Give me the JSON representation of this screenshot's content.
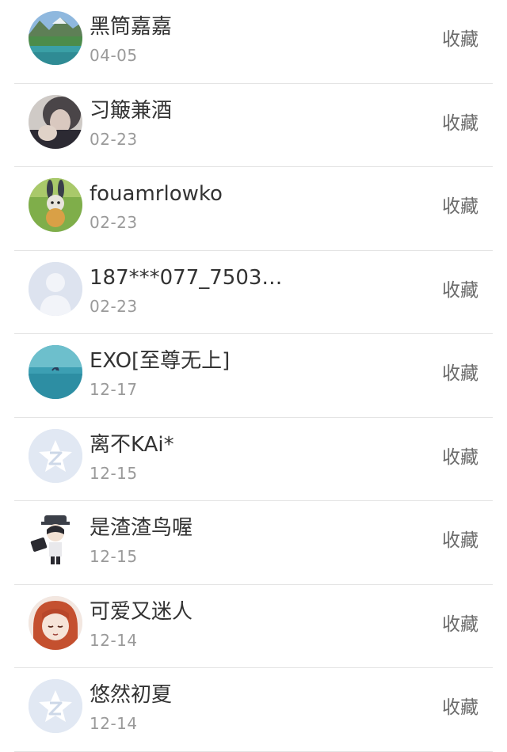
{
  "items": [
    {
      "name": "黑筒嘉嘉",
      "date": "04-05",
      "action": "收藏"
    },
    {
      "name": "习簸兼酒",
      "date": "02-23",
      "action": "收藏"
    },
    {
      "name": "fouamrlowko",
      "date": "02-23",
      "action": "收藏"
    },
    {
      "name": "187***077_7503…",
      "date": "02-23",
      "action": "收藏"
    },
    {
      "name": "EXO[至尊无上]",
      "date": "12-17",
      "action": "收藏"
    },
    {
      "name": "离不KAi*",
      "date": "12-15",
      "action": "收藏"
    },
    {
      "name": "是渣渣鸟喔",
      "date": "12-15",
      "action": "收藏"
    },
    {
      "name": "可爱又迷人",
      "date": "12-14",
      "action": "收藏"
    },
    {
      "name": "悠然初夏",
      "date": "12-14",
      "action": "收藏"
    }
  ]
}
